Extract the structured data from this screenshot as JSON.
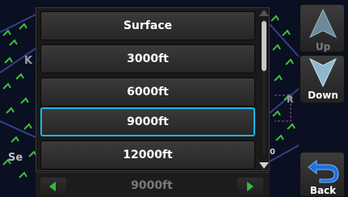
{
  "altitude_options": [
    {
      "label": "Surface",
      "selected": false
    },
    {
      "label": "3000ft",
      "selected": false
    },
    {
      "label": "6000ft",
      "selected": false
    },
    {
      "label": "9000ft",
      "selected": true
    },
    {
      "label": "12000ft",
      "selected": false
    }
  ],
  "knob": {
    "value": "9000ft"
  },
  "buttons": {
    "up": "Up",
    "down": "Down",
    "back": "Back"
  },
  "map": {
    "label_k": "K",
    "label_se": "Se",
    "label_r": "R",
    "label_zero": "0"
  },
  "colors": {
    "selection": "#17b8e8",
    "knob_arrow": "#2bbf3c",
    "up_icon": "#6e8a9a",
    "down_icon": "#8fb8cc",
    "back_icon": "#1e6fe0"
  }
}
